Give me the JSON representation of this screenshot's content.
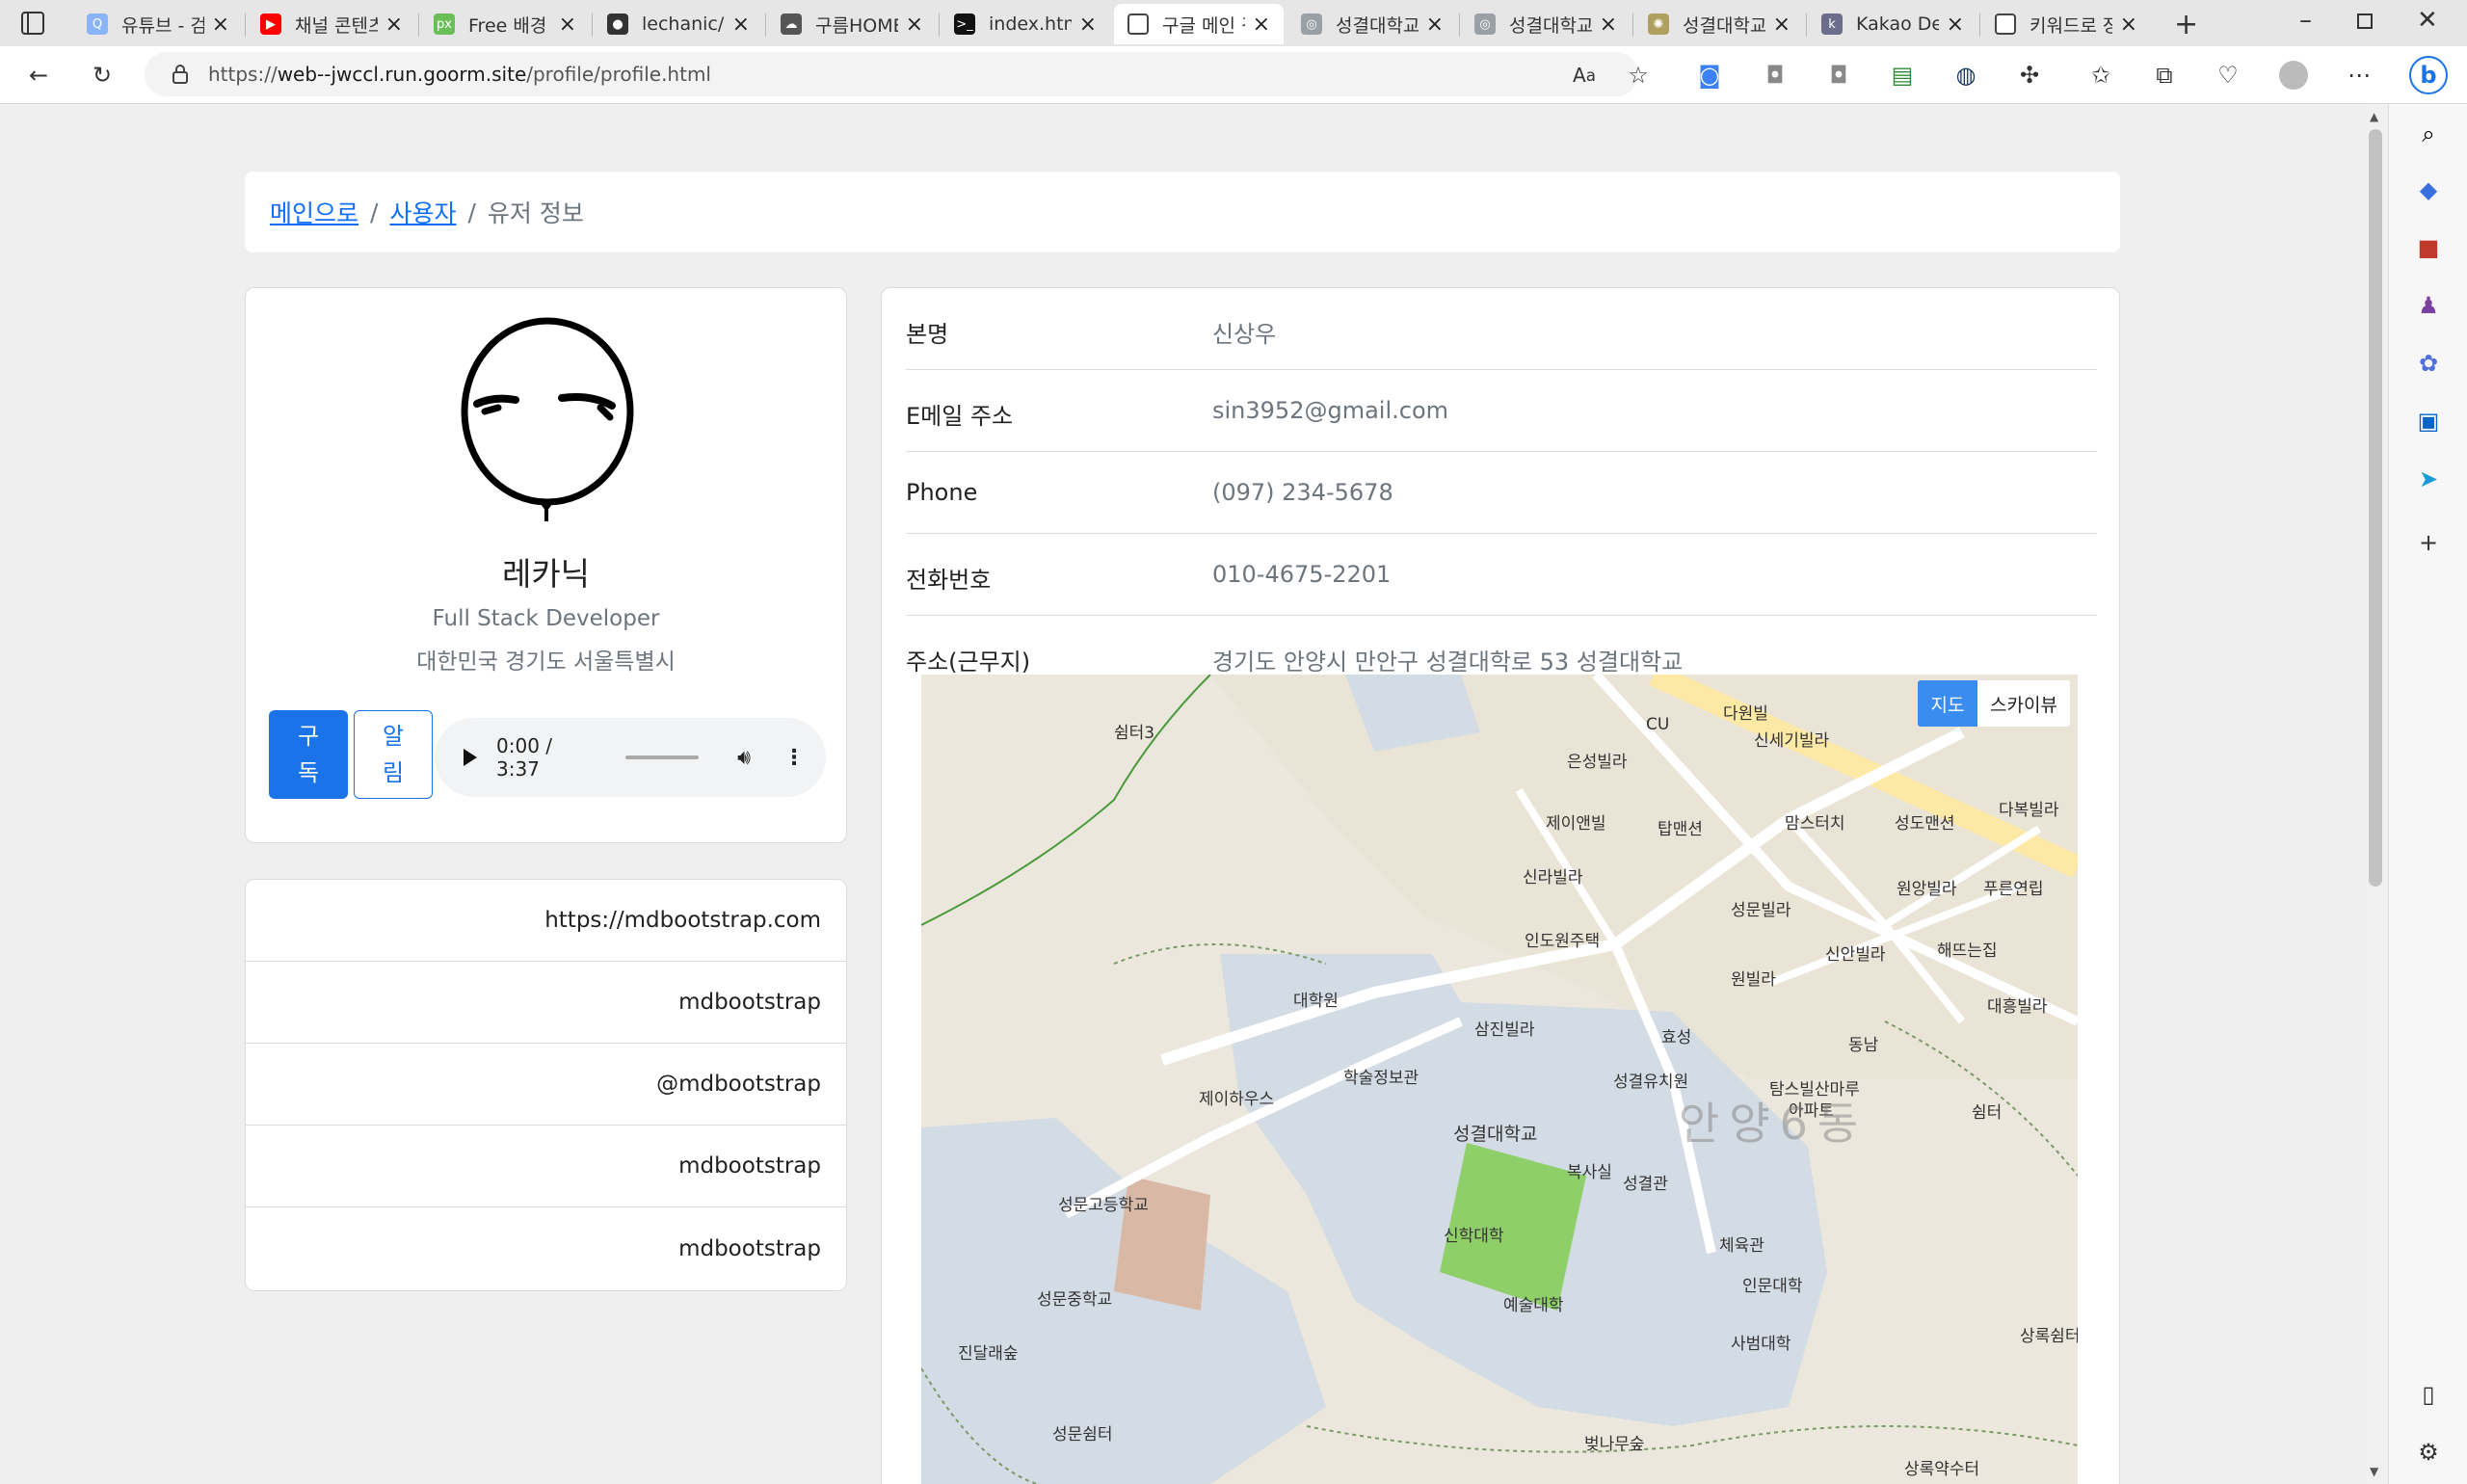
{
  "browser": {
    "tabs": [
      {
        "title": "유튜브 - 검",
        "color": "#8ab4f8",
        "glyph": "Q"
      },
      {
        "title": "채널 콘텐츠",
        "color": "#ff0000",
        "glyph": "▶"
      },
      {
        "title": "Free 배경",
        "color": "#6bbf59",
        "glyph": "px"
      },
      {
        "title": "lechanic/W",
        "color": "#333333",
        "glyph": "●"
      },
      {
        "title": "구름HOME",
        "color": "#555555",
        "glyph": "☁"
      },
      {
        "title": "index.html",
        "color": "#111111",
        "glyph": ">_"
      },
      {
        "title": "구글 메인 검",
        "color": "#ffffff",
        "glyph": "▯"
      },
      {
        "title": "성결대학교",
        "color": "#9aa0a6",
        "glyph": "◎"
      },
      {
        "title": "성결대학교",
        "color": "#9aa0a6",
        "glyph": "◎"
      },
      {
        "title": "성결대학교",
        "color": "#b0a060",
        "glyph": "✺"
      },
      {
        "title": "Kakao Dev",
        "color": "#6c6c8c",
        "glyph": "k"
      },
      {
        "title": "키워드로 장",
        "color": "#ffffff",
        "glyph": "▯"
      }
    ],
    "url_prefix": "https://",
    "url_host": "web--jwccl.run.goorm.site",
    "url_path": "/profile/profile.html"
  },
  "breadcrumb": {
    "home": "메인으로",
    "users": "사용자",
    "current": "유저 정보",
    "separator": "/"
  },
  "profile": {
    "name": "레카닉",
    "job": "Full Stack Developer",
    "location": "대한민국 경기도 서울특별시",
    "subscribe_label": "구\n독",
    "notify_label": "알\n림",
    "audio_time": "0:00 / 3:37"
  },
  "links": [
    "https://mdbootstrap.com",
    "mdbootstrap",
    "@mdbootstrap",
    "mdbootstrap",
    "mdbootstrap"
  ],
  "info": [
    {
      "label": "본명",
      "value": "신상우"
    },
    {
      "label": "E메일 주소",
      "value": "sin3952@gmail.com"
    },
    {
      "label": "Phone",
      "value": "(097) 234-5678"
    },
    {
      "label": "전화번호",
      "value": "010-4675-2201"
    },
    {
      "label": "주소(근무지)",
      "value": "경기도 안양시 만안구 성결대학로 53 성결대학교"
    }
  ],
  "map": {
    "type_map": "지도",
    "type_sky": "스카이뷰",
    "labels": [
      "쉼터3",
      "CU",
      "다원빌",
      "신세기빌라",
      "은성빌라",
      "맘스터치",
      "성도맨션",
      "다복빌라",
      "제이앤빌",
      "탑맨션",
      "신라빌라",
      "원앙빌라",
      "푸른연립",
      "성문빌라",
      "인도원주택",
      "신안빌라",
      "해뜨는집",
      "원빌라",
      "대학원",
      "삼진빌라",
      "대흥빌라",
      "효성",
      "동남",
      "성결유치원",
      "탐스빌산마루",
      "아파트",
      "학술정보관",
      "제이하우스",
      "성결대학교",
      "쉼터",
      "안양6동",
      "복사실",
      "성결관",
      "성문고등학교",
      "신학대학",
      "체육관",
      "인문대학",
      "성문중학교",
      "예술대학",
      "사범대학",
      "상록쉼터",
      "진달래숲",
      "성문쉼터",
      "벚나무숲",
      "상록약수터"
    ]
  },
  "colors": {
    "link": "#0d6efd",
    "primary_button": "#1a73e8",
    "muted_text": "#6c757d",
    "map_campus": "#d3dbe4",
    "map_field": "#8fcf6a",
    "map_road": "#ffffff",
    "map_main_road": "#fde9a6"
  }
}
